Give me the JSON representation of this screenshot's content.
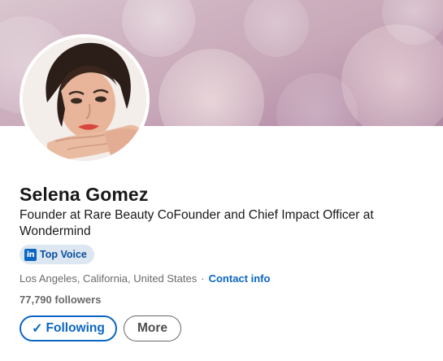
{
  "profile": {
    "name": "Selena Gomez",
    "headline": "Founder at Rare Beauty CoFounder and Chief Impact Officer at Wondermind",
    "badge": {
      "logo_text": "in",
      "label": "Top Voice"
    },
    "location": "Los Angeles, California, United States",
    "separator": "·",
    "contact_link": "Contact info",
    "followers": "77,790 followers"
  },
  "actions": {
    "following_icon": "✓",
    "following_label": "Following",
    "more_label": "More"
  },
  "colors": {
    "accent": "#0a66c2",
    "badge_bg": "#dde7f1"
  }
}
